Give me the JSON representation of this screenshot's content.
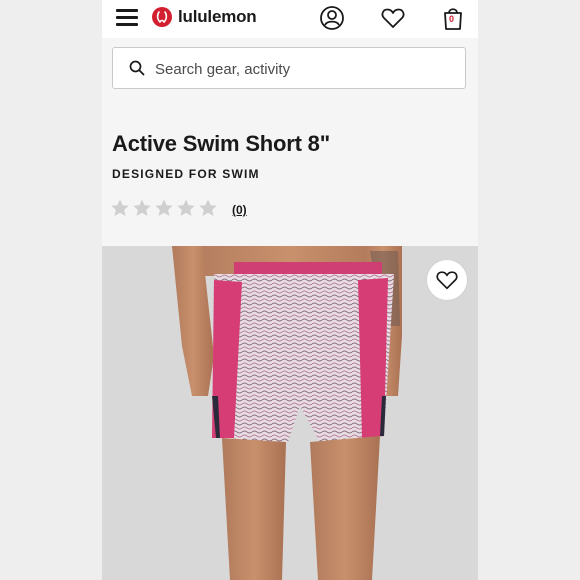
{
  "header": {
    "brand": "lululemon",
    "menu_icon": "hamburger-menu-icon",
    "account_icon": "account-icon",
    "wishlist_icon": "heart-icon",
    "bag_icon": "shopping-bag-icon",
    "bag_count": "0"
  },
  "search": {
    "placeholder": "Search gear, activity",
    "value": ""
  },
  "product": {
    "title": "Active Swim Short 8\"",
    "subtitle": "DESIGNED FOR SWIM",
    "rating": 0,
    "rating_max": 5,
    "review_count": "(0)",
    "favorite_icon": "heart-outline-icon"
  },
  "colors": {
    "brand_red": "#d22030",
    "short_pink": "#d63d74",
    "print_base": "#e7dde3",
    "star_empty": "#cfcfcf"
  }
}
